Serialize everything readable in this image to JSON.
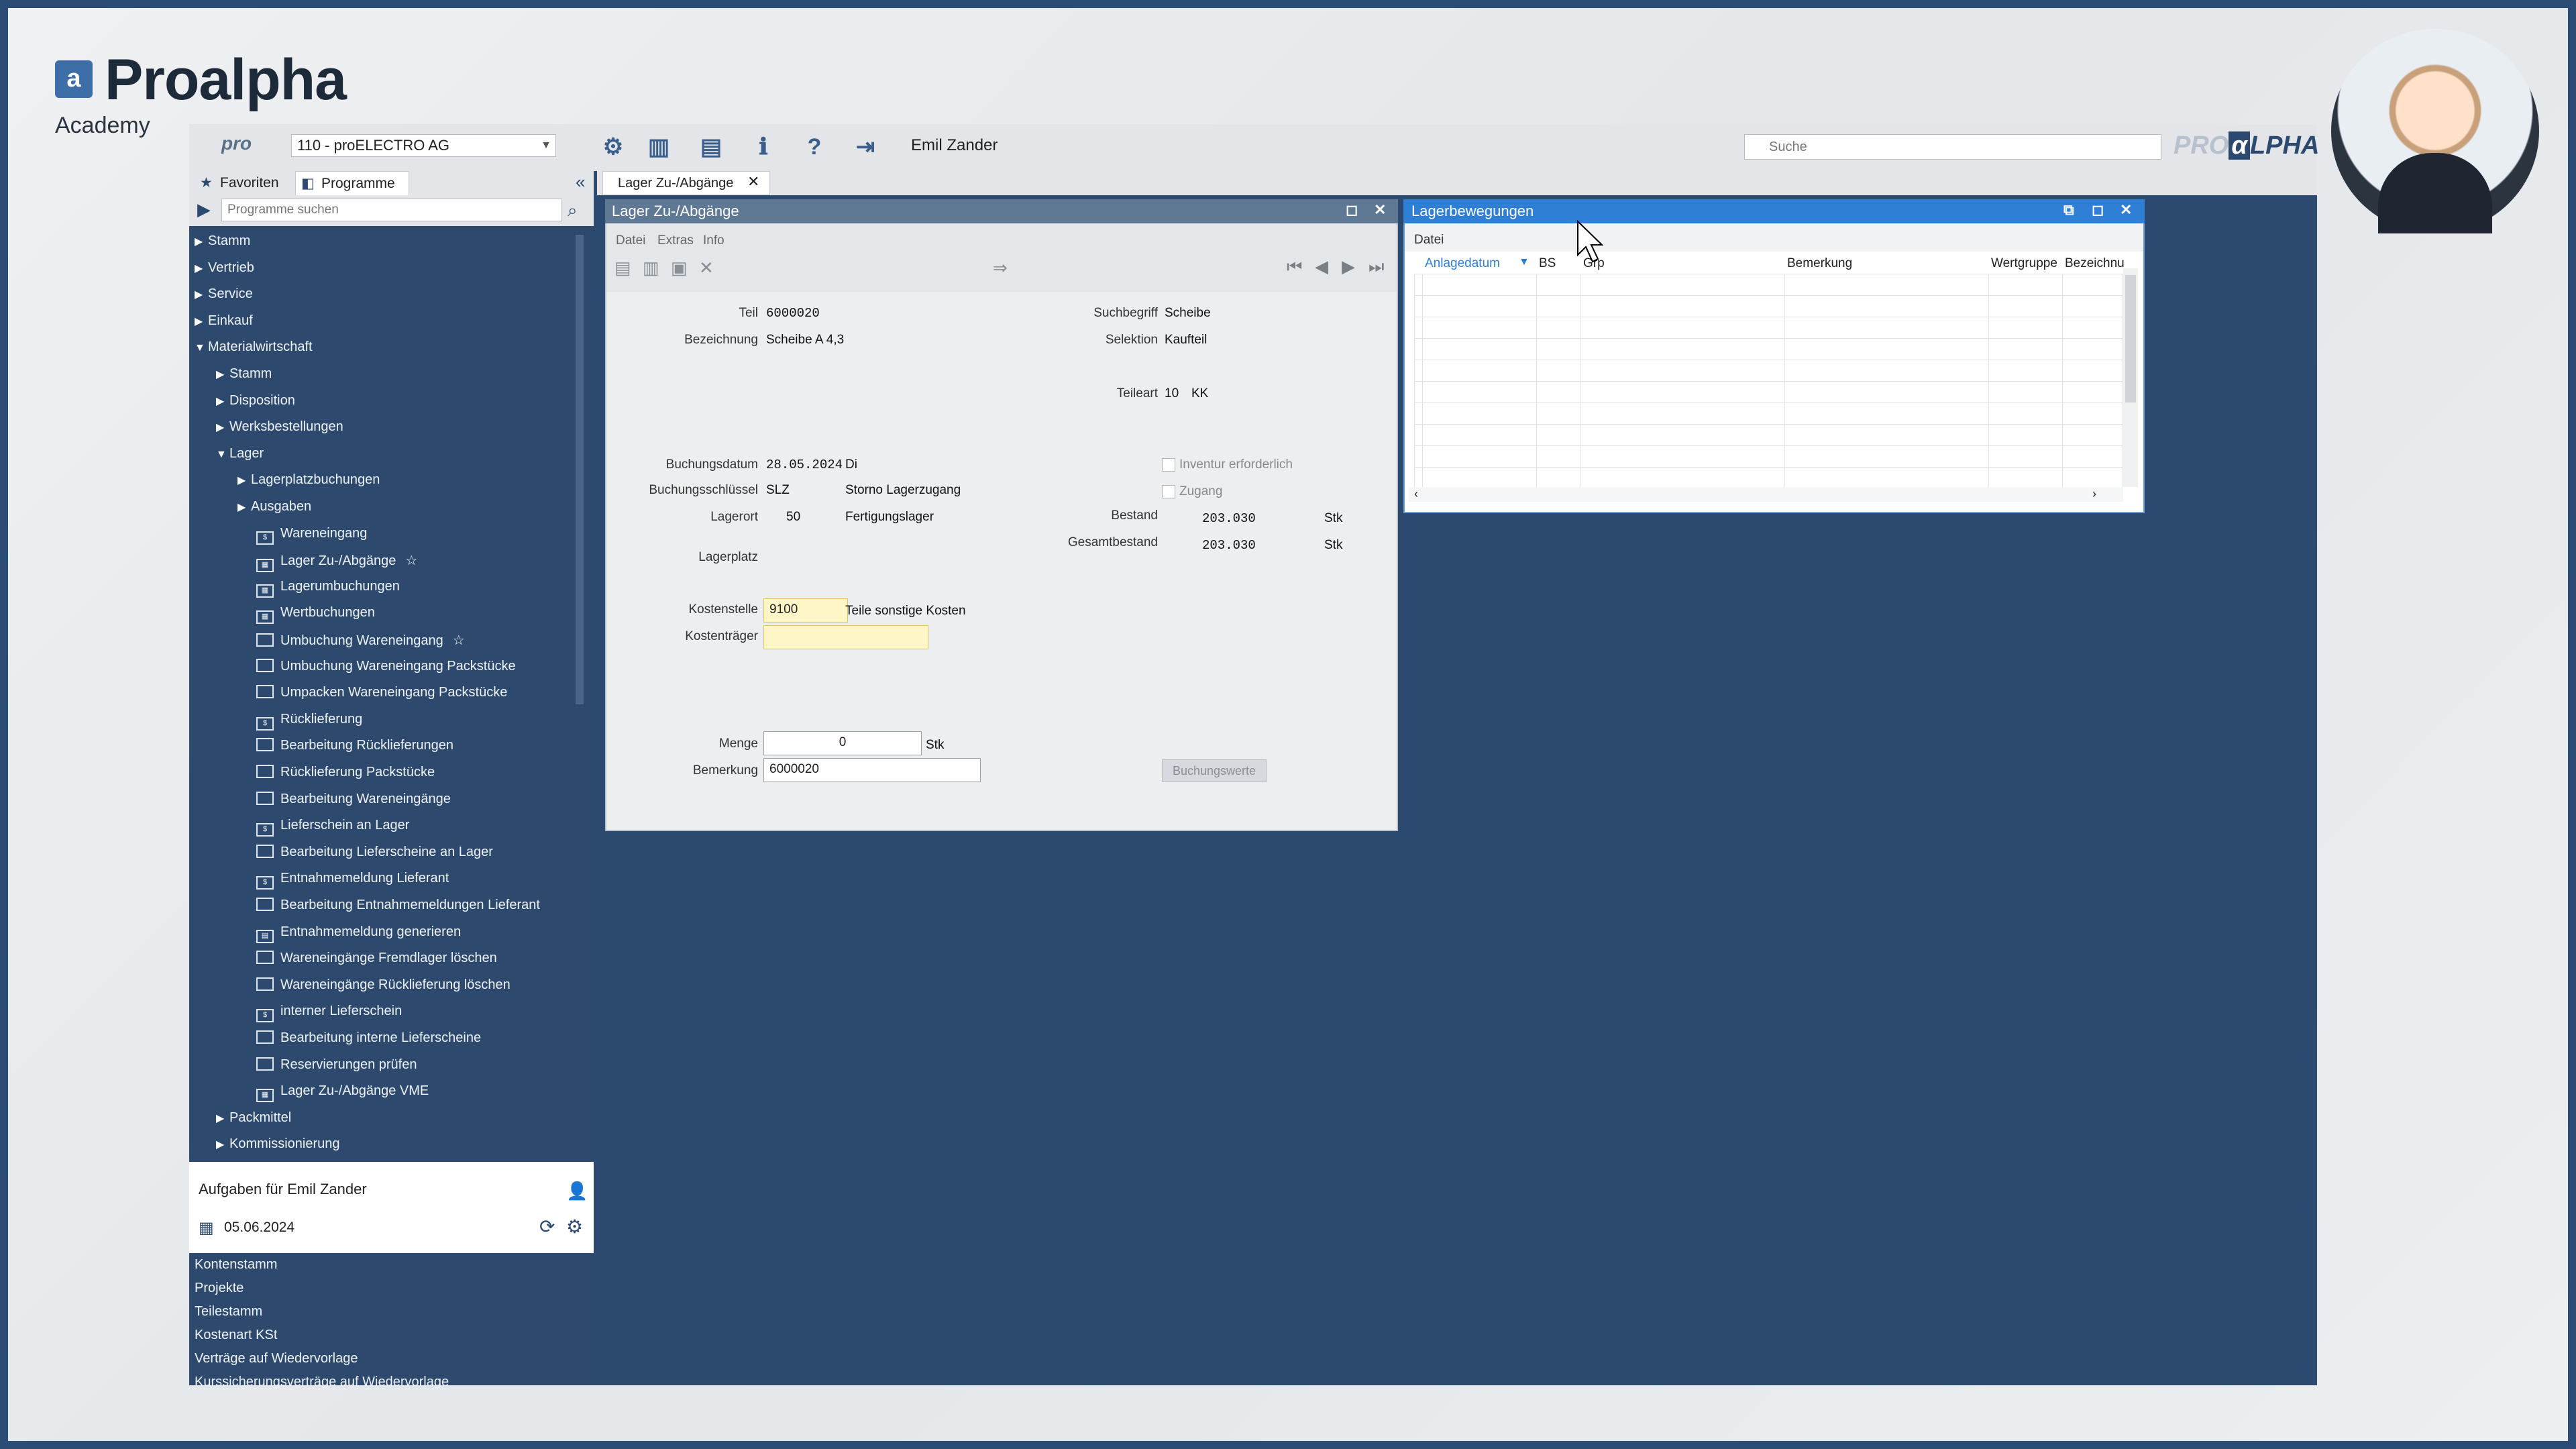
{
  "brand": {
    "mark": "a",
    "name": "Proalpha",
    "sub": "Academy"
  },
  "toolbar": {
    "pro_label": "pro",
    "company": "110 - proELECTRO AG",
    "user": "Emil Zander",
    "search_placeholder": "Suche",
    "logo_pro": "PRO",
    "logo_alpha": "α",
    "logo_lpha": "LPHA"
  },
  "nav": {
    "tab_favorites": "Favoriten",
    "tab_programs": "Programme",
    "search_placeholder": "Programme suchen",
    "tree": [
      {
        "label": "Stamm",
        "level": 0,
        "arrow": "▶"
      },
      {
        "label": "Vertrieb",
        "level": 0,
        "arrow": "▶"
      },
      {
        "label": "Service",
        "level": 0,
        "arrow": "▶"
      },
      {
        "label": "Einkauf",
        "level": 0,
        "arrow": "▶"
      },
      {
        "label": "Materialwirtschaft",
        "level": 0,
        "arrow": "▼"
      },
      {
        "label": "Stamm",
        "level": 1,
        "arrow": "▶"
      },
      {
        "label": "Disposition",
        "level": 1,
        "arrow": "▶"
      },
      {
        "label": "Werksbestellungen",
        "level": 1,
        "arrow": "▶"
      },
      {
        "label": "Lager",
        "level": 1,
        "arrow": "▼"
      },
      {
        "label": "Lagerplatzbuchungen",
        "level": 2,
        "arrow": "▶"
      },
      {
        "label": "Ausgaben",
        "level": 2,
        "arrow": "▶"
      },
      {
        "label": "Wareneingang",
        "level": 2,
        "icon": "$"
      },
      {
        "label": "Lager Zu-/Abgänge",
        "level": 2,
        "icon": "▦",
        "star": true
      },
      {
        "label": "Lagerumbuchungen",
        "level": 2,
        "icon": "▦"
      },
      {
        "label": "Wertbuchungen",
        "level": 2,
        "icon": "▦"
      },
      {
        "label": "Umbuchung Wareneingang",
        "level": 2,
        "icon": "",
        "star": true
      },
      {
        "label": "Umbuchung Wareneingang Packstücke",
        "level": 2,
        "icon": ""
      },
      {
        "label": "Umpacken Wareneingang Packstücke",
        "level": 2,
        "icon": ""
      },
      {
        "label": "Rücklieferung",
        "level": 2,
        "icon": "$"
      },
      {
        "label": "Bearbeitung Rücklieferungen",
        "level": 2,
        "icon": ""
      },
      {
        "label": "Rücklieferung Packstücke",
        "level": 2,
        "icon": ""
      },
      {
        "label": "Bearbeitung Wareneingänge",
        "level": 2,
        "icon": ""
      },
      {
        "label": "Lieferschein an Lager",
        "level": 2,
        "icon": "$"
      },
      {
        "label": "Bearbeitung Lieferscheine an Lager",
        "level": 2,
        "icon": ""
      },
      {
        "label": "Entnahmemeldung Lieferant",
        "level": 2,
        "icon": "$"
      },
      {
        "label": "Bearbeitung Entnahmemeldungen Lieferant",
        "level": 2,
        "icon": ""
      },
      {
        "label": "Entnahmemeldung generieren",
        "level": 2,
        "icon": "▤"
      },
      {
        "label": "Wareneingänge Fremdlager löschen",
        "level": 2,
        "icon": ""
      },
      {
        "label": "Wareneingänge Rücklieferung löschen",
        "level": 2,
        "icon": ""
      },
      {
        "label": "interner Lieferschein",
        "level": 2,
        "icon": "$"
      },
      {
        "label": "Bearbeitung interne Lieferscheine",
        "level": 2,
        "icon": ""
      },
      {
        "label": "Reservierungen prüfen",
        "level": 2,
        "icon": ""
      },
      {
        "label": "Lager Zu-/Abgänge VME",
        "level": 2,
        "icon": "▦"
      },
      {
        "label": "Packmittel",
        "level": 1,
        "arrow": "▶"
      },
      {
        "label": "Kommissionierung",
        "level": 1,
        "arrow": "▶"
      }
    ]
  },
  "tasks": {
    "title": "Aufgaben für Emil Zander",
    "date": "05.06.2024",
    "items": [
      "Kontenstamm",
      "Projekte",
      "Teilestamm",
      "Kostenart KSt",
      "Verträge auf Wiedervorlage",
      "Kurssicherungsverträge auf Wiedervorlage"
    ]
  },
  "doc_tab": {
    "label": "Lager Zu-/Abgänge",
    "close": "✕"
  },
  "lager": {
    "title": "Lager Zu-/Abgänge",
    "menu": [
      "Datei",
      "Extras",
      "Info"
    ],
    "fields": {
      "teil_label": "Teil",
      "teil": "6000020",
      "bezeichnung_label": "Bezeichnung",
      "bezeichnung": "Scheibe A 4,3",
      "suchbegriff_label": "Suchbegriff",
      "suchbegriff": "Scheibe",
      "selektion_label": "Selektion",
      "selektion": "Kaufteil",
      "teileart_label": "Teileart",
      "teileart_code": "10",
      "teileart": "KK",
      "buchungsdatum_label": "Buchungsdatum",
      "buchungsdatum": "28.05.2024",
      "wochentag": "Di",
      "buchungsschluessel_label": "Buchungsschlüssel",
      "buchungsschluessel": "SLZ",
      "buchungsschluessel_text": "Storno Lagerzugang",
      "lagerort_label": "Lagerort",
      "lagerort": "50",
      "lagerort_text": "Fertigungslager",
      "lagerplatz_label": "Lagerplatz",
      "inventur_label": "Inventur erforderlich",
      "zugang_label": "Zugang",
      "bestand_label": "Bestand",
      "bestand": "203.030",
      "bestand_unit": "Stk",
      "gesamtbestand_label": "Gesamtbestand",
      "gesamtbestand": "203.030",
      "gesamtbestand_unit": "Stk",
      "kostenstelle_label": "Kostenstelle",
      "kostenstelle": "9100",
      "kostenstelle_text": "Teile sonstige Kosten",
      "kostentraeger_label": "Kostenträger",
      "kostentraeger": "",
      "menge_label": "Menge",
      "menge": "0",
      "menge_unit": "Stk",
      "bemerkung_label": "Bemerkung",
      "bemerkung": "6000020",
      "button": "Buchungswerte"
    }
  },
  "bew": {
    "title": "Lagerbewegungen",
    "menu": "Datei",
    "columns": [
      "Anlagedatum",
      "BS",
      "Grp",
      "Bemerkung",
      "Wertgruppe",
      "Bezeichnu"
    ]
  }
}
